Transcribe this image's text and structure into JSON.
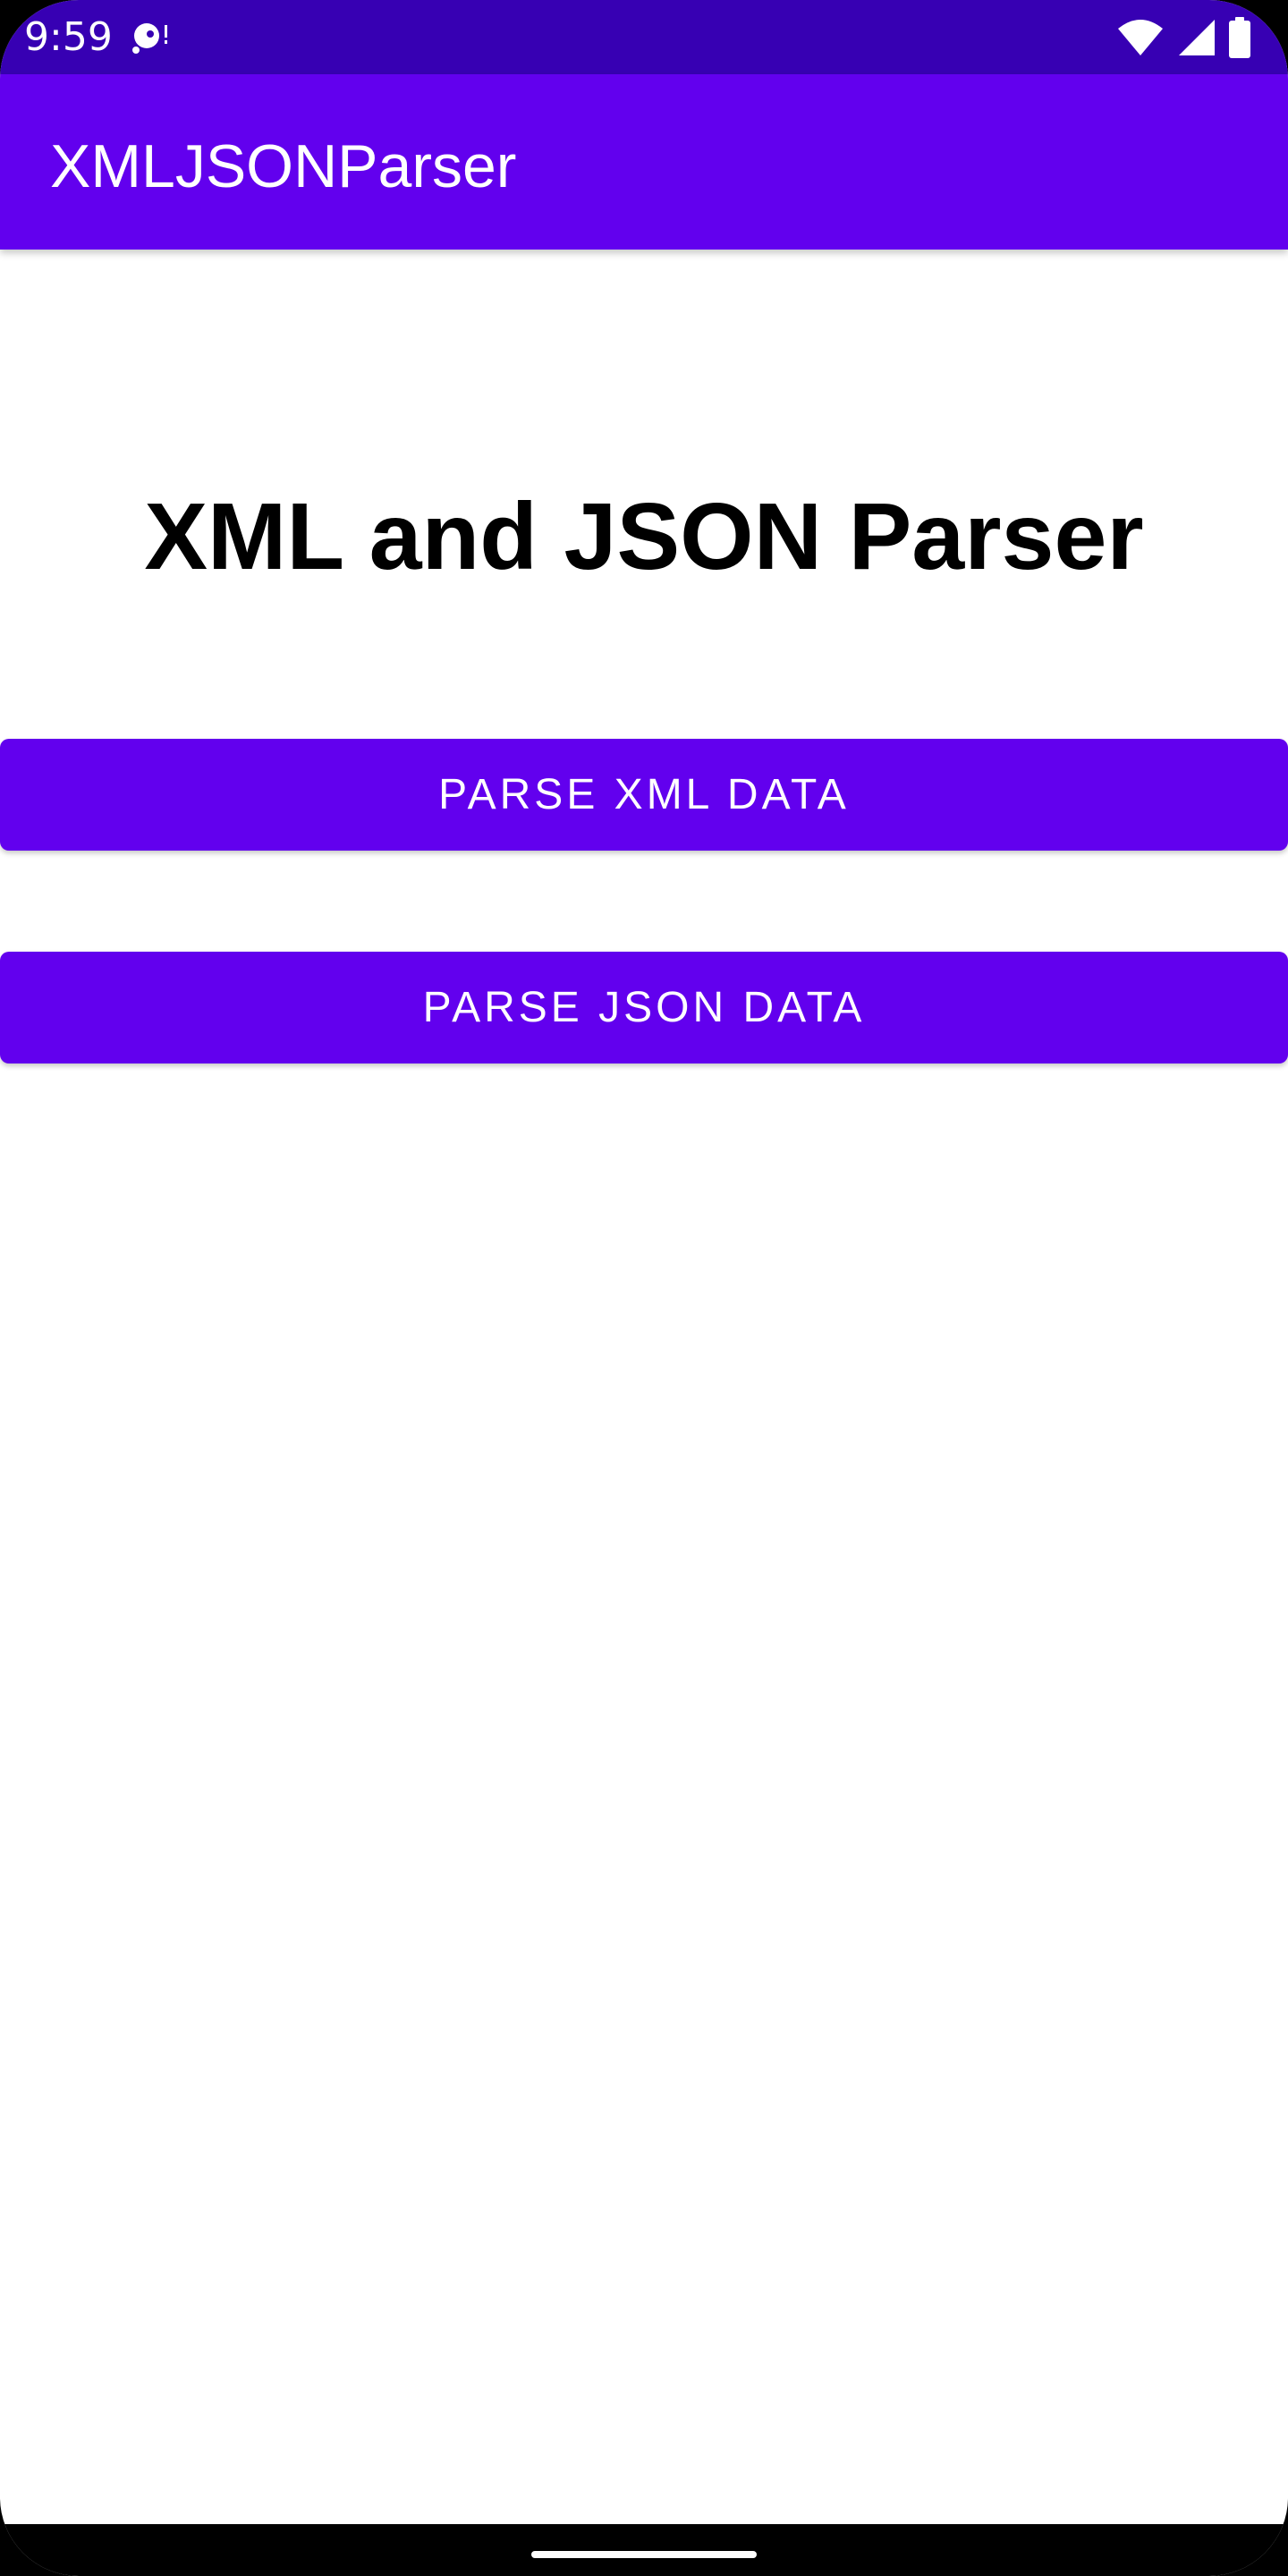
{
  "status_bar": {
    "time": "9:59",
    "left_icon": "media-sync-icon",
    "right_icons": [
      "wifi-icon",
      "cell-signal-icon",
      "battery-icon"
    ],
    "color": "#3700b3"
  },
  "app_bar": {
    "title": "XMLJSONParser",
    "color": "#6200ee"
  },
  "main": {
    "heading": "XML and JSON Parser",
    "buttons": [
      {
        "label": "PARSE XML DATA"
      },
      {
        "label": "PARSE JSON DATA"
      }
    ]
  },
  "nav_bar": {
    "handle": "home-gesture-handle"
  }
}
